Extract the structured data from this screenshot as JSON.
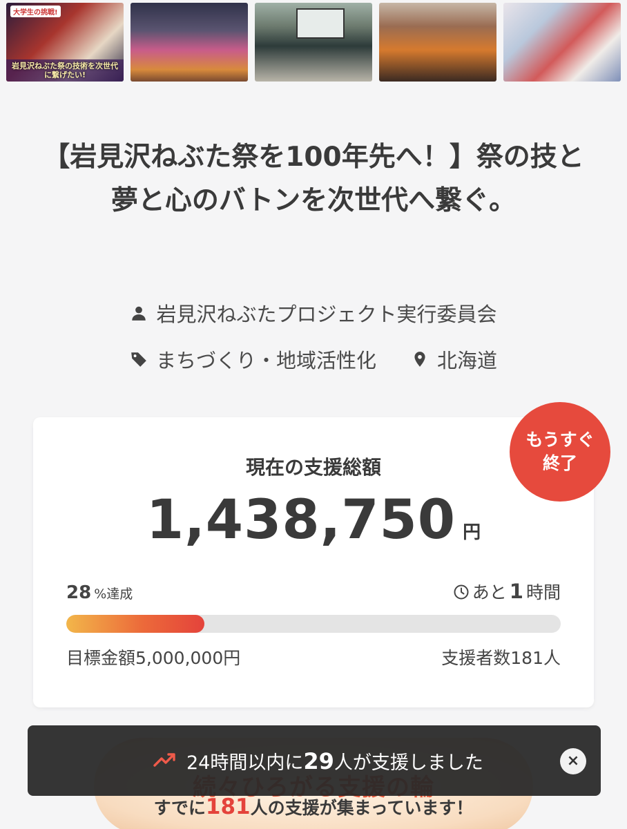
{
  "gallery": {
    "thumbnails": [
      {
        "badge": "大学生の挑戦!",
        "caption": "岩見沢ねぶた祭の技術を次世代に繋げたい!"
      },
      {
        "caption": ""
      },
      {
        "caption": ""
      },
      {
        "caption": ""
      },
      {
        "caption": ""
      }
    ]
  },
  "project": {
    "title": "【岩見沢ねぶた祭を100年先へ！】祭の技と夢と心のバトンを次世代へ繋ぐ。",
    "owner": "岩見沢ねぶたプロジェクト実行委員会",
    "category": "まちづくり・地域活性化",
    "location": "北海道"
  },
  "funding": {
    "label": "現在の支援総額",
    "amount": "1,438,750",
    "currency": "円",
    "percent": "28",
    "percent_unit": "%達成",
    "progress_fraction": 0.28,
    "remaining_prefix": "あと",
    "remaining_value": "1",
    "remaining_unit": "時間",
    "goal_label": "目標金額5,000,000円",
    "supporters_label": "支援者数",
    "supporters_value": "181",
    "supporters_unit": "人",
    "ending_badge": [
      "もうすぐ",
      "終了"
    ]
  },
  "promo": {
    "headline": "続々ひろがる支援の輪",
    "sub_prefix": "すでに",
    "sub_count": "181",
    "sub_suffix": "人の支援が集まっています！"
  },
  "toast": {
    "prefix": "24時間以内に",
    "count": "29",
    "suffix": "人が支援しました",
    "close_label": "×"
  },
  "colors": {
    "accent": "#e64a3d",
    "progress_start": "#f2b64a",
    "progress_end": "#e4433b",
    "background": "#f5f5f6"
  }
}
